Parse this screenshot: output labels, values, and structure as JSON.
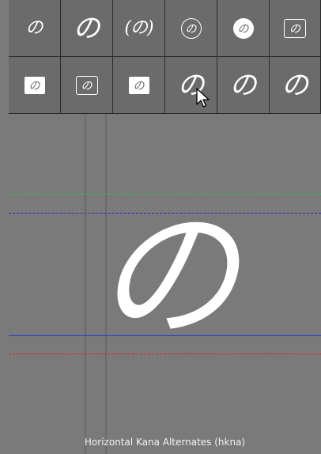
{
  "glyph_grid": {
    "row1": [
      {
        "kind": "plain",
        "text": "の"
      },
      {
        "kind": "plain",
        "text": "の"
      },
      {
        "kind": "paren",
        "text": "(の)"
      },
      {
        "kind": "circle-outline",
        "text": "の"
      },
      {
        "kind": "circle-solid",
        "text": "の"
      },
      {
        "kind": "box-outline",
        "text": "の"
      }
    ],
    "row2": [
      {
        "kind": "box-solid",
        "text": "の"
      },
      {
        "kind": "box-outline",
        "text": "の"
      },
      {
        "kind": "box-solid",
        "text": "の"
      },
      {
        "kind": "plain",
        "text": "の"
      },
      {
        "kind": "plain",
        "text": "の"
      },
      {
        "kind": "plain",
        "text": "の"
      }
    ]
  },
  "preview": {
    "glyph": "の",
    "caption": "Horizontal Kana Alternates (hkna)"
  },
  "guide_colors": {
    "green": "#22c55e",
    "blue_dashed": "#2b2bd8",
    "blue_solid": "#1f3ad6",
    "red": "#e11d1d"
  }
}
